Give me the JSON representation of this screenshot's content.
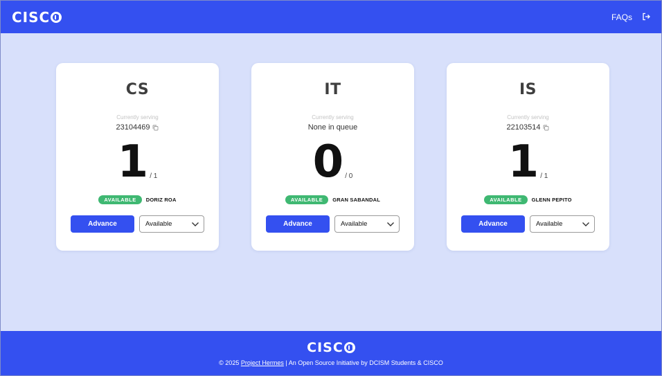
{
  "header": {
    "logo_text": "CISC",
    "faqs_label": "FAQs",
    "logout_icon": "logout-icon"
  },
  "cards": [
    {
      "title": "CS",
      "serving_caption": "Currently serving",
      "serving_value": "23104469",
      "show_copy": true,
      "count": "1",
      "total": "/ 1",
      "status": "AVAILABLE",
      "staff": "DORIZ ROA",
      "advance_label": "Advance",
      "select_value": "Available"
    },
    {
      "title": "IT",
      "serving_caption": "Currently serving",
      "serving_value": "None in queue",
      "show_copy": false,
      "count": "0",
      "total": "/ 0",
      "status": "AVAILABLE",
      "staff": "GRAN SABANDAL",
      "advance_label": "Advance",
      "select_value": "Available"
    },
    {
      "title": "IS",
      "serving_caption": "Currently serving",
      "serving_value": "22103514",
      "show_copy": true,
      "count": "1",
      "total": "/ 1",
      "status": "AVAILABLE",
      "staff": "GLENN PEPITO",
      "advance_label": "Advance",
      "select_value": "Available"
    }
  ],
  "footer": {
    "logo_text": "CISC",
    "copyright": "© 2025",
    "project_link": "Project Hermes",
    "tagline": "| An Open Source Initiative by DCISM Students & CISCO"
  },
  "colors": {
    "brand": "#3450f0",
    "background": "#d8e0fb",
    "available": "#3fb872"
  }
}
